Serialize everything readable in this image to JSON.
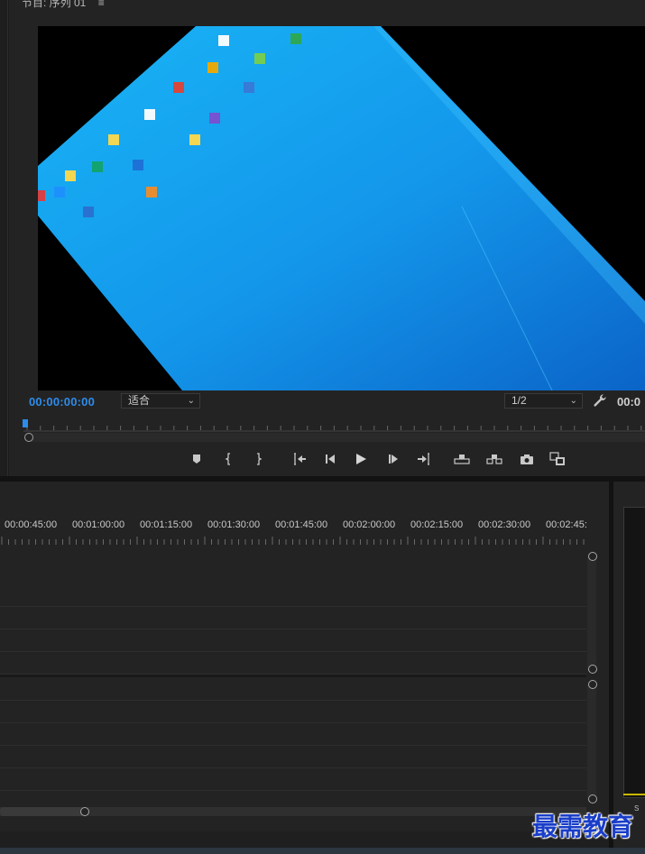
{
  "program_monitor": {
    "title": "节目: 序列 01",
    "menu_icon": "hamburger-menu-icon",
    "current_timecode": "00:00:00:00",
    "duration_timecode": "00:0",
    "fit_select": "适合",
    "resolution_select": "1/2"
  },
  "transport_controls": [
    {
      "name": "add-marker-button",
      "icon": "marker-icon"
    },
    {
      "name": "mark-in-button",
      "icon": "mark-in-icon"
    },
    {
      "name": "mark-out-button",
      "icon": "mark-out-icon"
    },
    {
      "name": "go-to-in-button",
      "icon": "go-to-in-icon"
    },
    {
      "name": "step-back-button",
      "icon": "step-back-icon"
    },
    {
      "name": "play-button",
      "icon": "play-icon"
    },
    {
      "name": "step-forward-button",
      "icon": "step-forward-icon"
    },
    {
      "name": "go-to-out-button",
      "icon": "go-to-out-icon"
    },
    {
      "name": "lift-button",
      "icon": "lift-icon"
    },
    {
      "name": "extract-button",
      "icon": "extract-icon"
    },
    {
      "name": "export-frame-button",
      "icon": "camera-icon"
    },
    {
      "name": "comparison-view-button",
      "icon": "comparison-icon"
    }
  ],
  "timeline": {
    "ruler_labels": [
      "00:00:45:00",
      "00:01:00:00",
      "00:01:15:00",
      "00:01:30:00",
      "00:01:45:00",
      "00:02:00:00",
      "00:02:15:00",
      "00:02:30:00",
      "00:02:45:"
    ]
  },
  "right_panel": {
    "label": "S"
  },
  "watermark": {
    "text": "最需教育",
    "color": "#1a3ec8"
  },
  "colors": {
    "timecode_blue": "#2d8ceb",
    "desktop_blue": "#1aa3ee"
  }
}
